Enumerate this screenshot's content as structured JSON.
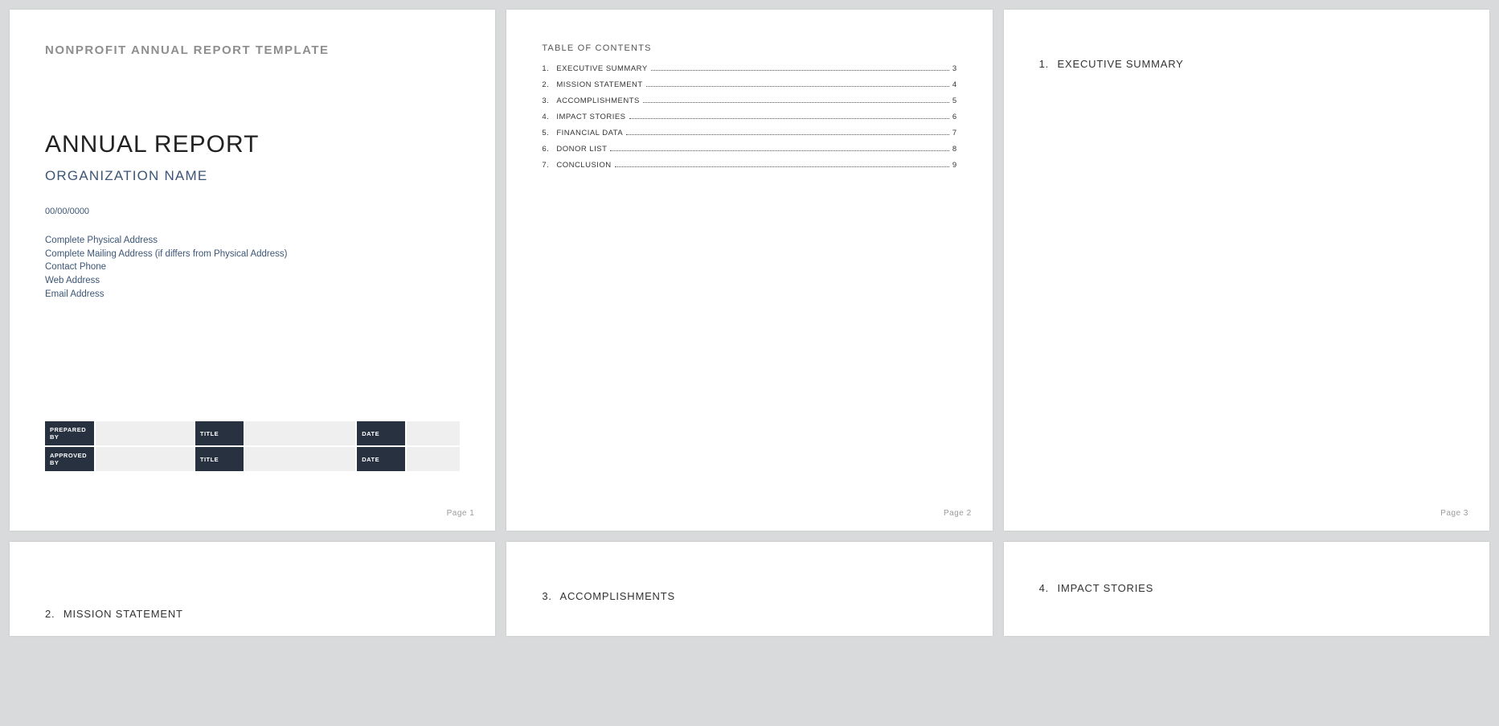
{
  "page1": {
    "template_label": "NONPROFIT ANNUAL REPORT TEMPLATE",
    "title": "ANNUAL REPORT",
    "org_name": "ORGANIZATION NAME",
    "date": "00/00/0000",
    "info": {
      "physical": "Complete Physical Address",
      "mailing": "Complete Mailing Address (if differs from Physical Address)",
      "phone": "Contact Phone",
      "web": "Web Address",
      "email": "Email Address"
    },
    "table": {
      "row1": {
        "c1": "PREPARED BY",
        "c2": "TITLE",
        "c3": "DATE"
      },
      "row2": {
        "c1": "APPROVED BY",
        "c2": "TITLE",
        "c3": "DATE"
      }
    },
    "page_lbl": "Page 1"
  },
  "page2": {
    "toc_title": "TABLE OF CONTENTS",
    "items": [
      {
        "n": "1.",
        "label": "EXECUTIVE SUMMARY",
        "pg": "3"
      },
      {
        "n": "2.",
        "label": "MISSION STATEMENT",
        "pg": "4"
      },
      {
        "n": "3.",
        "label": "ACCOMPLISHMENTS",
        "pg": "5"
      },
      {
        "n": "4.",
        "label": "IMPACT STORIES",
        "pg": "6"
      },
      {
        "n": "5.",
        "label": "FINANCIAL DATA",
        "pg": "7"
      },
      {
        "n": "6.",
        "label": "DONOR LIST",
        "pg": "8"
      },
      {
        "n": "7.",
        "label": "CONCLUSION",
        "pg": "9"
      }
    ],
    "page_lbl": "Page 2"
  },
  "page3": {
    "num": "1.",
    "title": "EXECUTIVE SUMMARY",
    "page_lbl": "Page 3"
  },
  "page4": {
    "num": "2.",
    "title": "MISSION STATEMENT"
  },
  "page5": {
    "num": "3.",
    "title": "ACCOMPLISHMENTS"
  },
  "page6": {
    "num": "4.",
    "title": "IMPACT STORIES"
  }
}
